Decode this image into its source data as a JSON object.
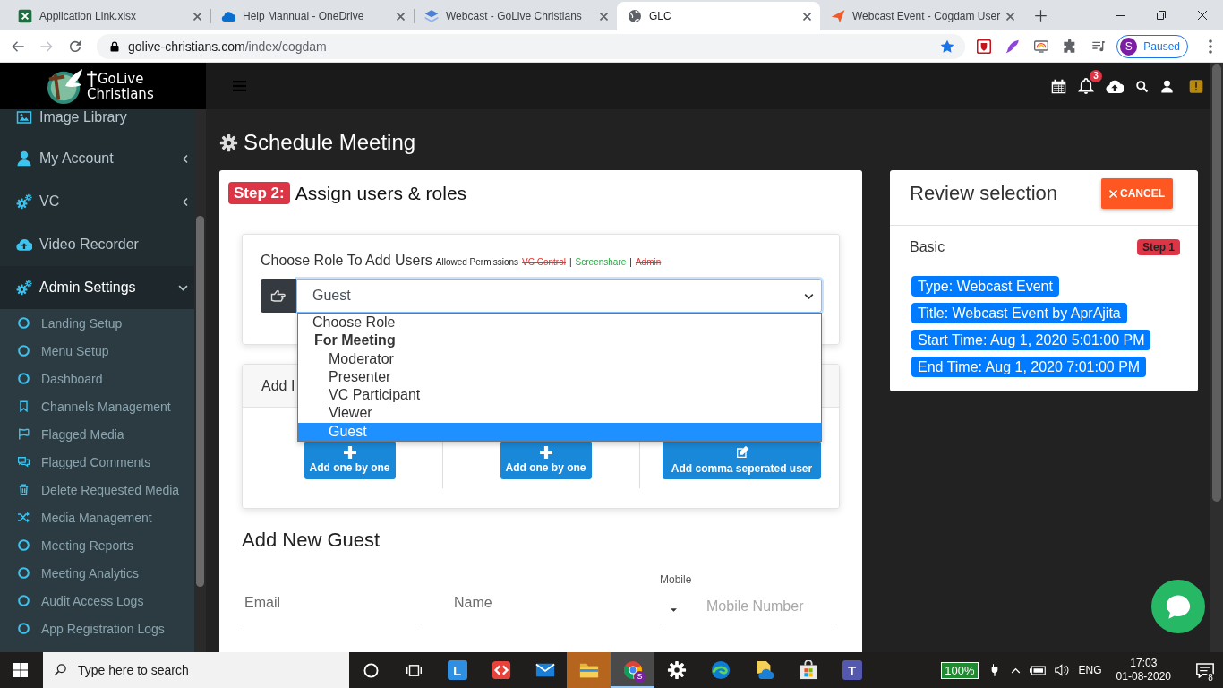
{
  "browser": {
    "tabs": [
      {
        "title": "Application Link.xlsx",
        "selected": false
      },
      {
        "title": "Help Mannual - OneDrive",
        "selected": false
      },
      {
        "title": "Webcast - GoLive Christians",
        "selected": false
      },
      {
        "title": "GLC",
        "selected": true
      },
      {
        "title": "Webcast Event - Cogdam User",
        "selected": false
      }
    ],
    "url": {
      "host": "golive-christians.com",
      "path": "/index/cogdam"
    },
    "profile": {
      "initial": "S",
      "status": "Paused"
    }
  },
  "sidebar": {
    "logo": {
      "lines": [
        "GoLive",
        "Christians"
      ]
    },
    "items": [
      {
        "kind": "link",
        "label": "Image Library",
        "selected": false
      },
      {
        "kind": "menu",
        "label": "My Account",
        "selected": false,
        "expanded": false
      },
      {
        "kind": "menu",
        "label": "VC",
        "selected": false,
        "expanded": false
      },
      {
        "kind": "link",
        "label": "Video Recorder",
        "selected": false
      },
      {
        "kind": "menu",
        "label": "Admin Settings",
        "selected": true,
        "expanded": true,
        "children": [
          {
            "label": "Landing Setup"
          },
          {
            "label": "Menu Setup"
          },
          {
            "label": "Dashboard"
          },
          {
            "label": "Channels Management"
          },
          {
            "label": "Flagged Media"
          },
          {
            "label": "Flagged Comments"
          },
          {
            "label": "Delete Requested Media"
          },
          {
            "label": "Media Management"
          },
          {
            "label": "Meeting Reports"
          },
          {
            "label": "Meeting Analytics"
          },
          {
            "label": "Audit Access Logs"
          },
          {
            "label": "App Registration Logs"
          }
        ]
      }
    ]
  },
  "navbar": {
    "notification_count": "3"
  },
  "page": {
    "title": "Schedule Meeting",
    "assign": {
      "step_badge": "Step 2:",
      "heading": "Assign users & roles",
      "role_picker": {
        "label": "Choose Role To Add Users",
        "permissions_caption": "Allowed Permissions",
        "permissions": [
          {
            "label": "VC Control",
            "allowed": false,
            "separator": "|"
          },
          {
            "label": "Screenshare",
            "allowed": true,
            "separator": "|"
          },
          {
            "label": "Admin",
            "allowed": false
          }
        ],
        "value": "Guest",
        "expanded": true,
        "options": [
          {
            "kind": "option",
            "label": "Choose Role",
            "selected": false
          },
          {
            "kind": "group",
            "label": "For Meeting"
          },
          {
            "kind": "suboption",
            "label": "Moderator",
            "selected": false
          },
          {
            "kind": "suboption",
            "label": "Presenter",
            "selected": false
          },
          {
            "kind": "suboption",
            "label": "VC Participant",
            "selected": false
          },
          {
            "kind": "suboption",
            "label": "Viewer",
            "selected": false
          },
          {
            "kind": "suboption",
            "label": "Guest",
            "selected": true
          }
        ]
      },
      "add_panel": {
        "header": "Add I",
        "buttons": [
          {
            "kind": "plus",
            "label": "Add one by one"
          },
          {
            "kind": "plus",
            "label": "Add one by one"
          },
          {
            "kind": "edit",
            "label": "Add comma seperated user"
          }
        ]
      },
      "guest_form": {
        "heading": "Add New Guest",
        "fields": [
          {
            "kind": "text",
            "placeholder": "Email"
          },
          {
            "kind": "text",
            "placeholder": "Name"
          },
          {
            "kind": "phone",
            "label": "Mobile",
            "placeholder": "Mobile Number"
          }
        ]
      }
    },
    "review": {
      "title": "Review selection",
      "cancel": "CANCEL",
      "section": "Basic",
      "step_badge": "Step 1",
      "tags": [
        "Type: Webcast Event",
        "Title: Webcast Event by AprAjita",
        "Start Time: Aug 1, 2020 5:01:00 PM",
        "End Time: Aug 1, 2020 7:01:00 PM"
      ]
    }
  },
  "taskbar": {
    "search_placeholder": "Type here to search",
    "apps": [
      {
        "selected": false,
        "flashing": false,
        "glyph": "L"
      },
      {
        "selected": false,
        "flashing": false
      },
      {
        "selected": false,
        "flashing": false
      },
      {
        "selected": false,
        "flashing": true
      },
      {
        "selected": true,
        "flashing": false,
        "badge": "S"
      },
      {
        "selected": false,
        "flashing": false
      },
      {
        "selected": false,
        "flashing": false
      },
      {
        "selected": false,
        "flashing": false
      },
      {
        "selected": false,
        "flashing": false
      },
      {
        "selected": false,
        "flashing": false,
        "glyph": "T"
      }
    ],
    "tray": {
      "battery": "100%",
      "language": "ENG",
      "time": "17:03",
      "date": "01-08-2020",
      "notifications": "8"
    }
  }
}
